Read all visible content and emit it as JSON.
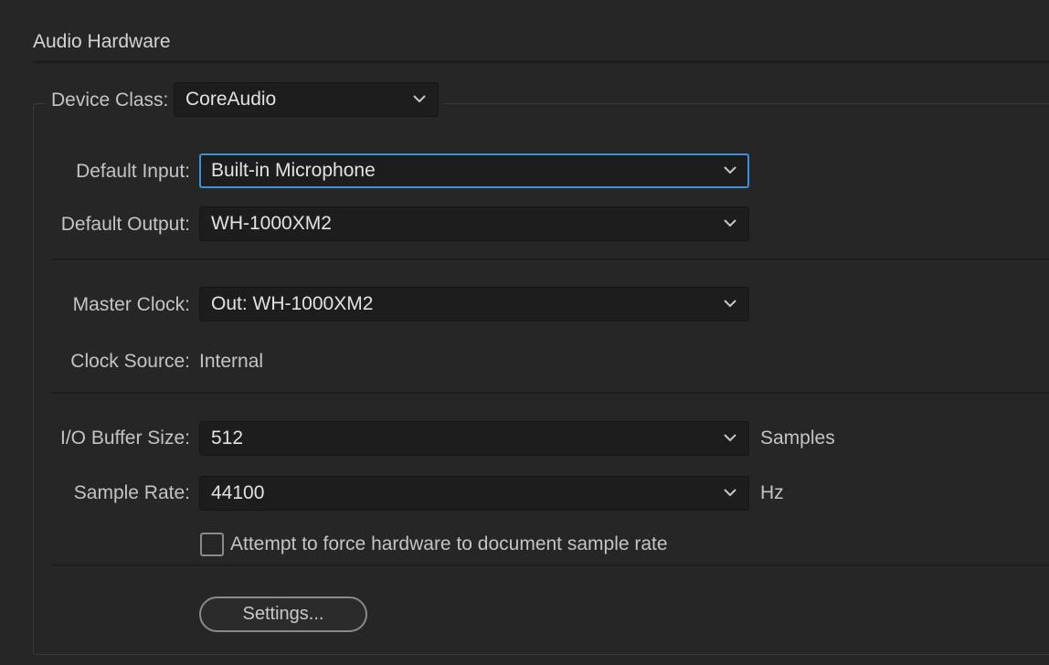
{
  "section": {
    "title": "Audio Hardware"
  },
  "device_class": {
    "label": "Device Class:",
    "value": "CoreAudio"
  },
  "default_input": {
    "label": "Default Input:",
    "value": "Built-in Microphone"
  },
  "default_output": {
    "label": "Default Output:",
    "value": "WH-1000XM2"
  },
  "master_clock": {
    "label": "Master Clock:",
    "value": "Out: WH-1000XM2"
  },
  "clock_source": {
    "label": "Clock Source:",
    "value": "Internal"
  },
  "buffer_size": {
    "label": "I/O Buffer Size:",
    "value": "512",
    "unit": "Samples"
  },
  "sample_rate": {
    "label": "Sample Rate:",
    "value": "44100",
    "unit": "Hz"
  },
  "force_rate": {
    "label": "Attempt to force hardware to document sample rate",
    "checked": false
  },
  "settings_button": {
    "label": "Settings..."
  },
  "icons": {
    "dropdown": "chevron-down-icon"
  },
  "colors": {
    "background": "#262626",
    "field": "#1d1d1d",
    "focus_ring": "#3d8fd8",
    "text": "#c4c4c4"
  }
}
